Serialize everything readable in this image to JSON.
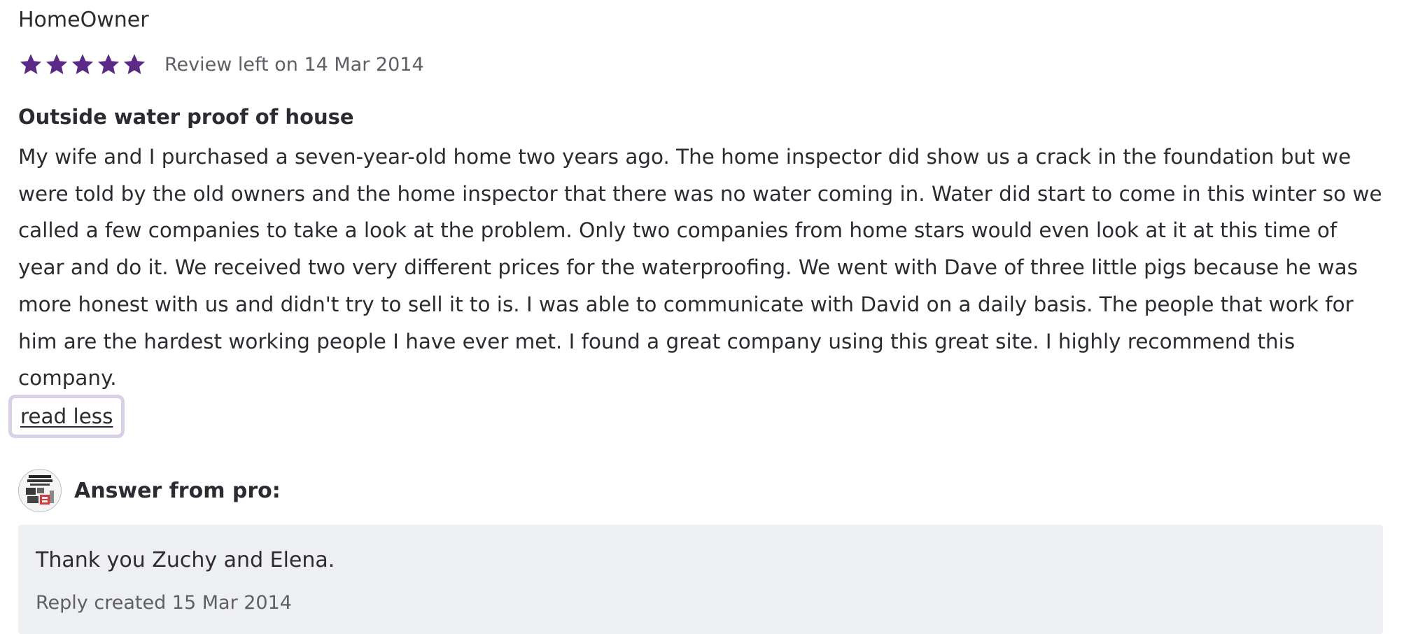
{
  "review": {
    "author": "HomeOwner",
    "rating": 5,
    "rating_max": 5,
    "star_color": "#5b2a86",
    "date_text": "Review left on 14 Mar 2014",
    "title": "Outside water proof of house",
    "body": "My wife and I purchased a seven-year-old home two years ago. The home inspector did show us a crack in the foundation but we were told by the old owners and the home inspector that there was no water coming in. Water did start to come in this winter so we called a few companies to take a look at the problem. Only two companies from home stars would even look at it at this time of year and do it. We received two very different prices for the waterproofing. We went with Dave of three little pigs because he was more honest with us and didn't try to sell it to is. I was able to communicate with David on a daily basis. The people that work for him are the hardest working people I have ever met. I found a great company using this great site. I highly recommend this company.",
    "read_less_label": "read less"
  },
  "pro_answer": {
    "label": "Answer from pro:",
    "avatar_icon": "company-logo-avatar",
    "reply_text": "Thank you Zuchy and Elena.",
    "reply_date": "Reply created 15 Mar 2014",
    "box_color": "#eeeff3"
  },
  "colors": {
    "focus_ring": "#d9cfe6",
    "text": "#2b2b31",
    "muted_text": "#5f5f66"
  }
}
